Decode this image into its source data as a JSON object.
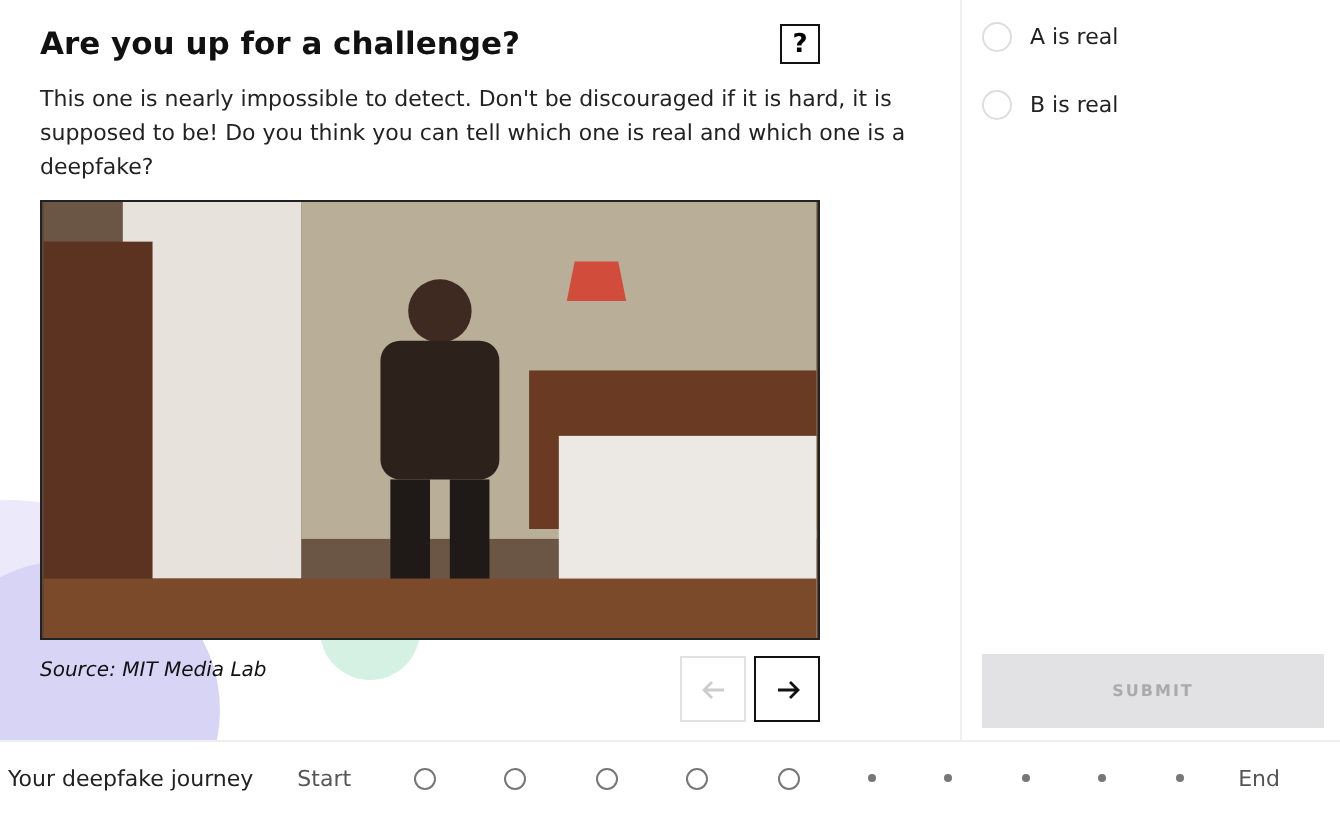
{
  "question": {
    "title": "Are you up for a challenge?",
    "help": "?",
    "text": "This one is nearly impossible to detect. Don't be discouraged if it is hard, it is supposed to be! Do you think you can tell which one is real and which one is a deepfake?",
    "source": "Source: MIT Media Lab"
  },
  "nav": {
    "prev_disabled": true,
    "next_disabled": false
  },
  "options": [
    {
      "label": "A is real",
      "selected": false
    },
    {
      "label": "B is real",
      "selected": false
    }
  ],
  "submit": {
    "label": "SUBMIT",
    "disabled": true
  },
  "journey": {
    "label": "Your deepfake journey",
    "start": "Start",
    "end": "End",
    "steps": [
      {
        "kind": "circle"
      },
      {
        "kind": "circle"
      },
      {
        "kind": "circle"
      },
      {
        "kind": "circle"
      },
      {
        "kind": "circle"
      },
      {
        "kind": "dot"
      },
      {
        "kind": "dot"
      },
      {
        "kind": "dot"
      },
      {
        "kind": "dot"
      },
      {
        "kind": "dot"
      }
    ]
  }
}
